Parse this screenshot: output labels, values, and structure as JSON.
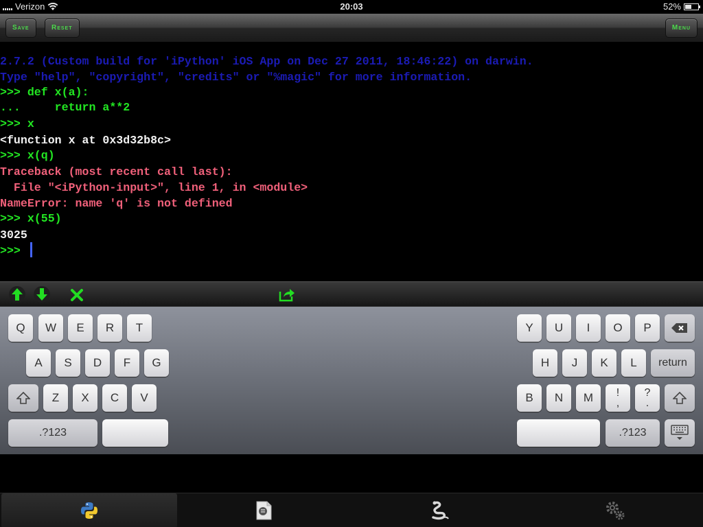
{
  "status_bar": {
    "carrier": "Verizon",
    "time": "20:03",
    "battery": "52%",
    "battery_level": 0.52
  },
  "toolbar": {
    "save_label": "Save",
    "reset_label": "Reset",
    "menu_label": "Menu"
  },
  "console": {
    "lines": [
      "2.7.2 (Custom build for 'iPython' iOS App on Dec 27 2011, 18:46:22) on darwin.",
      "Type \"help\", \"copyright\", \"credits\" or \"%magic\" for more information.",
      ">>> def x(a):",
      "...     return a**2",
      ">>> x",
      "<function x at 0x3d32b8c>",
      ">>> x(q)",
      "Traceback (most recent call last):",
      "  File \"<iPython-input>\", line 1, in <module>",
      "NameError: name 'q' is not defined",
      ">>> x(55)",
      "3025",
      ">>> "
    ]
  },
  "accessory_bar": {
    "icons": [
      "arrow-up-icon",
      "arrow-down-icon",
      "close-icon",
      "share-icon"
    ]
  },
  "keyboard": {
    "row1_left": [
      "Q",
      "W",
      "E",
      "R",
      "T"
    ],
    "row1_right": [
      "Y",
      "U",
      "I",
      "O",
      "P"
    ],
    "row2_left": [
      "A",
      "S",
      "D",
      "F",
      "G"
    ],
    "row2_right": [
      "H",
      "J",
      "K",
      "L"
    ],
    "return_label": "return",
    "row3_left": [
      "Z",
      "X",
      "C",
      "V"
    ],
    "row3_right": [
      "B",
      "N",
      "M"
    ],
    "punct1_top": "!",
    "punct1_bottom": ",",
    "punct2_top": "?",
    "punct2_bottom": ".",
    "numbers_label": ".?123"
  },
  "tab_bar": {
    "tabs": [
      "python-icon",
      "script-icon",
      "snake-icon",
      "settings-icon"
    ]
  }
}
